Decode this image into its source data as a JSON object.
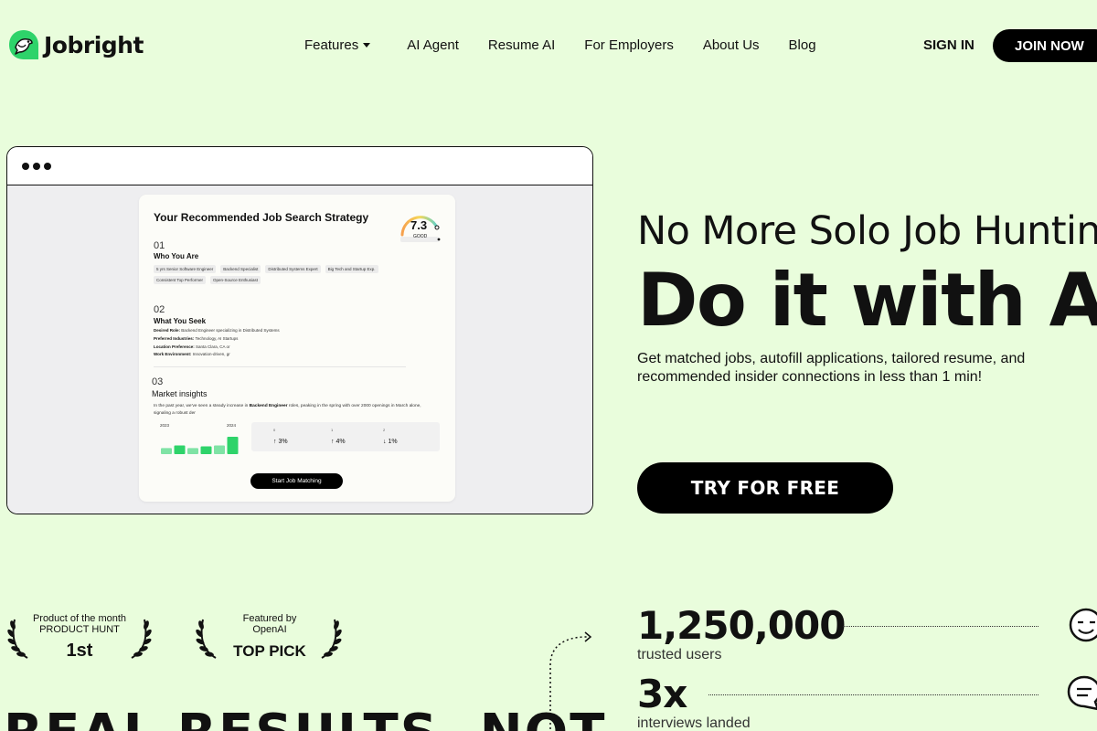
{
  "brand": {
    "name": "Jobright",
    "accent": "#2ed36a",
    "background": "#e9fddc"
  },
  "nav": {
    "links": [
      "Features",
      "AI Agent",
      "Resume AI",
      "For Employers",
      "About Us",
      "Blog"
    ],
    "signin": "SIGN IN",
    "join": "JOIN NOW"
  },
  "mockup": {
    "title": "Your Recommended Job Search Strategy",
    "score": "7.3",
    "score_label": "GOOD",
    "section1": {
      "num": "01",
      "title": "Who You Are",
      "tags": [
        "5 yrs Senior Software Engineer",
        "Backend Specialist",
        "Distributed Systems Expert",
        "Big Tech and Startup Exp.",
        "Consistent Top Performer",
        "Open-Source Enthusiast"
      ]
    },
    "section2": {
      "num": "02",
      "title": "What You Seek",
      "rows": [
        {
          "k": "Desired Role:",
          "v": "Backend Engineer specializing in Distributed Systems"
        },
        {
          "k": "Preferred Industries:",
          "v": "Technology, AI Startups"
        },
        {
          "k": "Location Preference:",
          "v": "Santa Clara, CA or"
        },
        {
          "k": "Work Environment:",
          "v": "Innovation-driven, gr"
        }
      ]
    },
    "section3": {
      "num": "03",
      "title": "Market insights",
      "text_pre": "In the past year, we've seen a steady increase in ",
      "text_bold": "Backend Engineer",
      "text_post": " roles, peaking in the spring with over 2000 openings in March alone, signaling a robust der",
      "years": [
        "2023",
        "2024"
      ],
      "bars": [
        0.35,
        0.5,
        0.35,
        0.45,
        0.5,
        1.0
      ],
      "stats": [
        {
          "n": "0",
          "v": "3%",
          "dir": "up"
        },
        {
          "n": "1",
          "v": "4%",
          "dir": "up"
        },
        {
          "n": "2",
          "v": "1%",
          "dir": "down"
        }
      ]
    },
    "start_button": "Start Job Matching"
  },
  "hero": {
    "line1": "No More Solo Job Hunting",
    "line2": "Do it with AI",
    "subtitle": "Get matched jobs, autofill applications, tailored resume, and recommended insider connections in less than 1 min!",
    "cta": "TRY FOR FREE"
  },
  "awards": [
    {
      "line1": "Product of the month",
      "line2": "PRODUCT HUNT",
      "big": "1st"
    },
    {
      "line1": "Featured by",
      "line2": "OpenAI",
      "big": "TOP PICK"
    }
  ],
  "stats": [
    {
      "value": "1,250,000",
      "label": "trusted users",
      "icon": "smile-face-icon"
    },
    {
      "value": "3x",
      "label": "interviews landed",
      "icon": "chat-bubble-icon"
    }
  ],
  "section_heading": "REAL RESULTS, NOT"
}
